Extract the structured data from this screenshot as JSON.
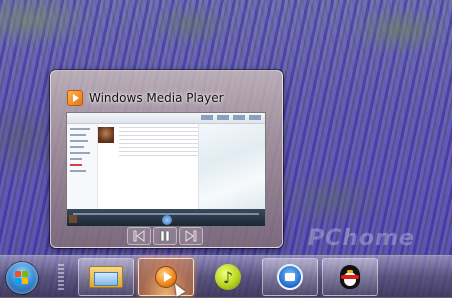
{
  "thumbnail_preview": {
    "window_title": "Windows Media Player",
    "app_icon": "windows-media-player-icon",
    "controls": [
      {
        "name": "previous-track-button",
        "icon": "skip-previous-icon"
      },
      {
        "name": "play-pause-button",
        "icon": "pause-icon"
      },
      {
        "name": "next-track-button",
        "icon": "skip-next-icon"
      }
    ]
  },
  "taskbar": {
    "start_button_icon": "windows-logo-icon",
    "pinned_items": [
      {
        "name": "windows-explorer-taskbar-button",
        "icon": "folder-explorer-icon",
        "active": false
      },
      {
        "name": "windows-media-player-taskbar-button",
        "icon": "media-player-icon",
        "active": true
      },
      {
        "name": "music-app-taskbar-button",
        "icon": "music-note-icon",
        "active": false
      },
      {
        "name": "internet-explorer-taskbar-button",
        "icon": "ie-icon",
        "active": false
      },
      {
        "name": "qq-taskbar-button",
        "icon": "qq-penguin-icon",
        "active": false
      }
    ]
  },
  "watermark": "PChome",
  "colors": {
    "wallpaper_lavender": "#5a4fb3",
    "active_taskbar_glow": "#f08a3a",
    "start_orb": "#3a8fd6"
  }
}
